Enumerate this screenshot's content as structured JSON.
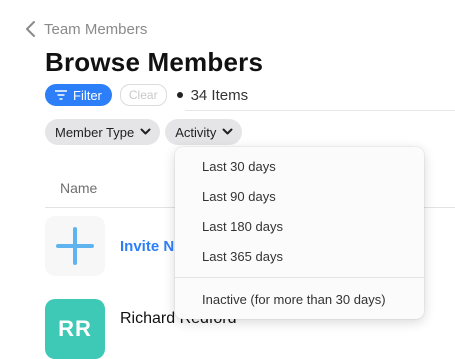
{
  "nav": {
    "back_label": "Team Members"
  },
  "page": {
    "title": "Browse Members"
  },
  "filters": {
    "filter_label": "Filter",
    "clear_label": "Clear",
    "count_label": "34 Items"
  },
  "chips": [
    {
      "label": "Member Type"
    },
    {
      "label": "Activity"
    }
  ],
  "table": {
    "column_name": "Name"
  },
  "invite": {
    "label": "Invite N"
  },
  "members": [
    {
      "initials": "RR",
      "name": "Richard Redford"
    }
  ],
  "activity_menu": {
    "items": [
      "Last 30 days",
      "Last 90 days",
      "Last 180 days",
      "Last 365 days"
    ],
    "inactive_item": "Inactive (for more than 30 days)"
  },
  "colors": {
    "accent": "#2d7ff9",
    "invite_plus": "#5fb4ef",
    "avatar_bg": "#3ec9b6"
  },
  "icons": [
    "chevron-left-icon",
    "filter-icon",
    "chevron-down-icon",
    "plus-icon"
  ]
}
